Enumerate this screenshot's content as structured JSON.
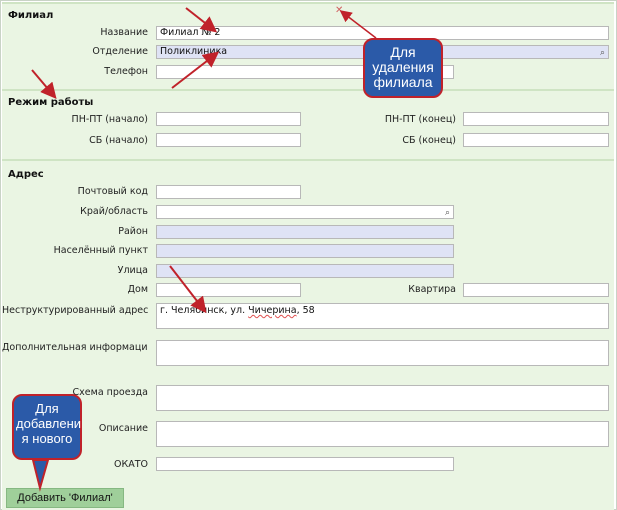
{
  "branch": {
    "title": "Филиал",
    "name_label": "Название",
    "name_value": "Филиал № 2",
    "department_label": "Отделение",
    "department_value": "Поликлиника",
    "phone_label": "Телефон",
    "phone_value": ""
  },
  "schedule": {
    "title": "Режим работы",
    "weekday_start_label": "ПН-ПТ (начало)",
    "weekday_end_label": "ПН-ПТ (конец)",
    "sat_start_label": "СБ (начало)",
    "sat_end_label": "СБ (конец)"
  },
  "address": {
    "title": "Адрес",
    "postal_label": "Почтовый код",
    "region_label": "Край/область",
    "district_label": "Район",
    "locality_label": "Населённый пункт",
    "street_label": "Улица",
    "house_label": "Дом",
    "apartment_label": "Квартира",
    "unstructured_label": "Неструктурированный адрес",
    "unstructured_value_a": "г. Челя",
    "unstructured_value_b": "бинск, ул. ",
    "unstructured_value_c": "Чичерина",
    "unstructured_value_d": ", 58",
    "extra_info_label": "Дополнительная информаци",
    "route_label": "Схема проезда",
    "description_label": "Описание",
    "okato_label": "ОКАТО"
  },
  "callouts": {
    "delete_text": "Для удаления филиала",
    "add_text": "Для добавлени я нового"
  },
  "actions": {
    "add_label": "Добавить 'Филиал'"
  },
  "icons": {
    "lookup": "magnifier-icon",
    "close": "close-x-icon"
  },
  "colors": {
    "section_bg": "#eaf5e3",
    "readonly_bg": "#dfe3f5",
    "callout_bg": "#2b5aa8",
    "callout_border": "#c0222a",
    "arrow": "#c0222a",
    "button_bg": "#9fcf9a"
  }
}
